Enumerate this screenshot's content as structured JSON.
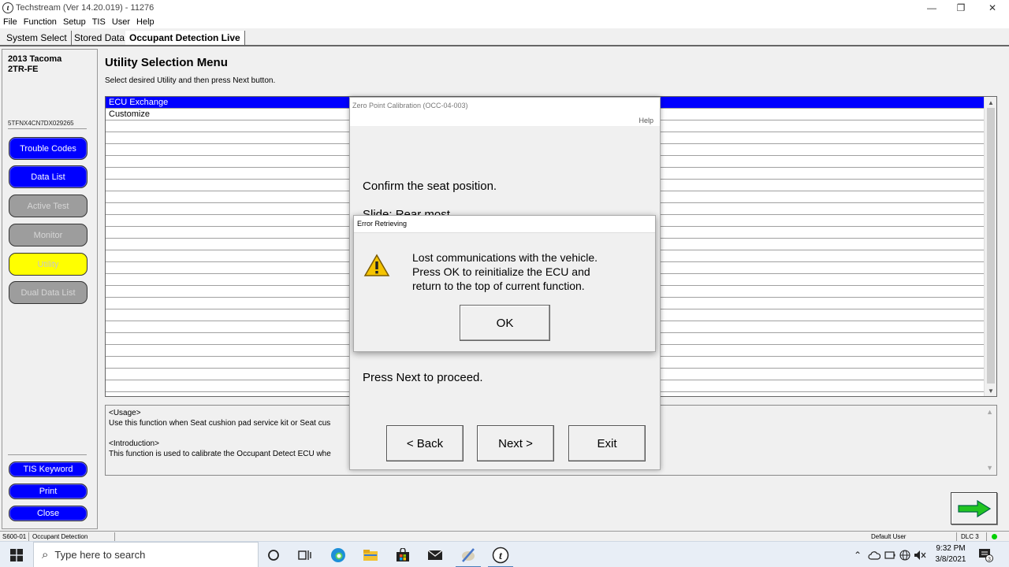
{
  "window": {
    "title": "Techstream (Ver 14.20.019) - 11276",
    "app_icon_glyph": "t",
    "controls": [
      "—",
      "❐",
      "✕"
    ]
  },
  "menu": [
    "File",
    "Function",
    "Setup",
    "TIS",
    "User",
    "Help"
  ],
  "tabs": [
    {
      "label": "System Select",
      "active": false
    },
    {
      "label": "Stored Data",
      "active": false
    },
    {
      "label": "Occupant Detection Live",
      "active": true
    }
  ],
  "vehicle": {
    "model": "2013 Tacoma",
    "engine": "2TR-FE",
    "vin": "5TFNX4CN7DX029265"
  },
  "nav": [
    {
      "label": "Trouble Codes",
      "state": "blue"
    },
    {
      "label": "Data List",
      "state": "blue"
    },
    {
      "label": "Active Test",
      "state": "grey"
    },
    {
      "label": "Monitor",
      "state": "grey"
    },
    {
      "label": "Utility",
      "state": "yellow"
    },
    {
      "label": "Dual Data List",
      "state": "grey"
    }
  ],
  "bottom_nav": [
    "TIS Keyword",
    "Print",
    "Close"
  ],
  "main": {
    "title": "Utility Selection Menu",
    "subtitle": "Select desired Utility and then press Next button.",
    "list_items": [
      "ECU Exchange",
      "Customize"
    ],
    "usage_heading": "<Usage>",
    "usage_text": "Use this function when Seat cushion pad service kit or Seat cus",
    "intro_heading": "<Introduction>",
    "intro_text": "This function is used to calibrate the Occupant Detect ECU whe"
  },
  "statusbar": {
    "code": "S600-01",
    "function": "Occupant Detection",
    "user": "Default User",
    "dlc": "DLC 3"
  },
  "calibration_dialog": {
    "title": "Zero Point Calibration (OCC-04-003)",
    "help": "Help",
    "line1": "Confirm the seat position.",
    "line2": "Slide: Rear most",
    "line3": "Press Next to proceed.",
    "back": "< Back",
    "next": "Next >",
    "exit": "Exit"
  },
  "error_dialog": {
    "title": "Error Retrieving",
    "msg1": "Lost communications with the vehicle.",
    "msg2": "Press OK to reinitialize the ECU and",
    "msg3": "return to the top of current function.",
    "ok": "OK"
  },
  "taskbar": {
    "search_placeholder": "Type here to search",
    "time": "9:32 PM",
    "date": "3/8/2021",
    "notification_count": "3"
  },
  "colors": {
    "nav_blue": "#0000ff",
    "nav_grey": "#9d9d9d",
    "nav_yellow": "#ffff00",
    "highlight": "#0000ff",
    "status_green": "#00d000"
  }
}
